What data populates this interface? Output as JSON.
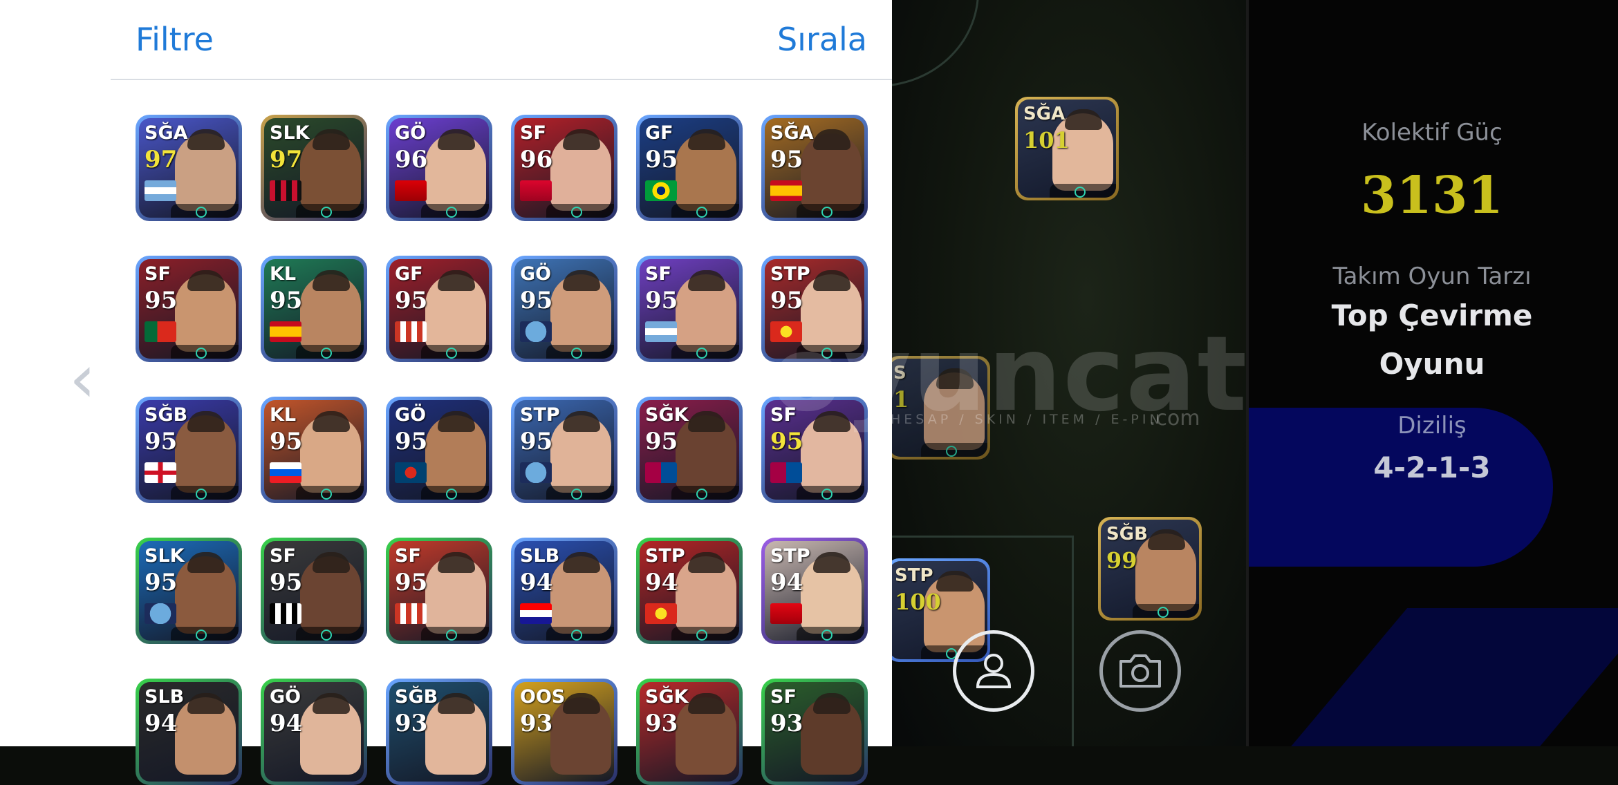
{
  "panel": {
    "filter_label": "Filtre",
    "sort_label": "Sırala"
  },
  "players": [
    {
      "pos": "SĞA",
      "rating": "97",
      "gold": true,
      "frame": "#6aa6ff",
      "bg": "#4a56c8",
      "skin": "#caa083",
      "flag": "argentina"
    },
    {
      "pos": "SLK",
      "rating": "97",
      "gold": true,
      "frame": "#c9a24a",
      "bg": "#2b4a2a",
      "skin": "#7b5035",
      "flag": "acmilan"
    },
    {
      "pos": "GÖ",
      "rating": "96",
      "gold": false,
      "frame": "#6aa6ff",
      "bg": "#6c3fd0",
      "skin": "#e2b79b",
      "flag": "arsenal"
    },
    {
      "pos": "SF",
      "rating": "96",
      "gold": false,
      "frame": "#6aa6ff",
      "bg": "#b32028",
      "skin": "#e0b09a",
      "flag": "bayern"
    },
    {
      "pos": "GF",
      "rating": "95",
      "gold": false,
      "frame": "#6aa6ff",
      "bg": "#1c3e84",
      "skin": "#a9764e",
      "flag": "brazil"
    },
    {
      "pos": "SĞA",
      "rating": "95",
      "gold": false,
      "frame": "#6aa6ff",
      "bg": "#a56c22",
      "skin": "#6b4430",
      "flag": "spain"
    },
    {
      "pos": "SF",
      "rating": "95",
      "gold": false,
      "frame": "#6aa6ff",
      "bg": "#8b1f28",
      "skin": "#c9956f",
      "flag": "portugal"
    },
    {
      "pos": "KL",
      "rating": "95",
      "gold": false,
      "frame": "#6aa6ff",
      "bg": "#1f7a55",
      "skin": "#b98561",
      "flag": "spain"
    },
    {
      "pos": "GF",
      "rating": "95",
      "gold": false,
      "frame": "#6aa6ff",
      "bg": "#9e1f2a",
      "skin": "#e3b69a",
      "flag": "atletico"
    },
    {
      "pos": "GÖ",
      "rating": "95",
      "gold": false,
      "frame": "#6aa6ff",
      "bg": "#3e73b5",
      "skin": "#cf9c7b",
      "flag": "mancity"
    },
    {
      "pos": "SF",
      "rating": "95",
      "gold": false,
      "frame": "#6aa6ff",
      "bg": "#6f3fc0",
      "skin": "#d5a184",
      "flag": "argentina"
    },
    {
      "pos": "STP",
      "rating": "95",
      "gold": false,
      "frame": "#6aa6ff",
      "bg": "#a82a2a",
      "skin": "#e4bba1",
      "flag": "manutd"
    },
    {
      "pos": "SĞB",
      "rating": "95",
      "gold": false,
      "frame": "#6aa6ff",
      "bg": "#3a3aa8",
      "skin": "#8a5b40",
      "flag": "england"
    },
    {
      "pos": "KL",
      "rating": "95",
      "gold": false,
      "frame": "#6aa6ff",
      "bg": "#c2552a",
      "skin": "#d9a886",
      "flag": "slovenia"
    },
    {
      "pos": "GÖ",
      "rating": "95",
      "gold": false,
      "frame": "#6aa6ff",
      "bg": "#1f2f7a",
      "skin": "#b27d58",
      "flag": "psg"
    },
    {
      "pos": "STP",
      "rating": "95",
      "gold": false,
      "frame": "#6aa6ff",
      "bg": "#3b67b0",
      "skin": "#e0b398",
      "flag": "mancity"
    },
    {
      "pos": "SĞK",
      "rating": "95",
      "gold": false,
      "frame": "#6aa6ff",
      "bg": "#8a1d4a",
      "skin": "#6a4231",
      "flag": "barcelona"
    },
    {
      "pos": "SF",
      "rating": "95",
      "gold": true,
      "frame": "#6aa6ff",
      "bg": "#5a2f8f",
      "skin": "#e2b7a0",
      "flag": "barcelona"
    },
    {
      "pos": "SLK",
      "rating": "95",
      "gold": false,
      "frame": "#38d24a",
      "bg": "#1c6bb8",
      "skin": "#8b5a3e",
      "flag": "mancity"
    },
    {
      "pos": "SF",
      "rating": "95",
      "gold": false,
      "frame": "#38d24a",
      "bg": "#3a3a3a",
      "skin": "#6b4432",
      "flag": "fulham"
    },
    {
      "pos": "SF",
      "rating": "95",
      "gold": false,
      "frame": "#38d24a",
      "bg": "#c23a2a",
      "skin": "#e0b49b",
      "flag": "atletico"
    },
    {
      "pos": "SLB",
      "rating": "94",
      "gold": false,
      "frame": "#6aa6ff",
      "bg": "#2a4fb0",
      "skin": "#c99676",
      "flag": "croatia"
    },
    {
      "pos": "STP",
      "rating": "94",
      "gold": false,
      "frame": "#38d24a",
      "bg": "#b42525",
      "skin": "#d9a58b",
      "flag": "manutd"
    },
    {
      "pos": "STP",
      "rating": "94",
      "gold": false,
      "frame": "#9b5de5",
      "bg": "#c8b7b0",
      "skin": "#e6c3a5",
      "flag": "munich"
    },
    {
      "pos": "SLB",
      "rating": "94",
      "gold": false,
      "frame": "#38d24a",
      "bg": "#2a2a2a",
      "skin": "#c3906d",
      "flag": "none"
    },
    {
      "pos": "GÖ",
      "rating": "94",
      "gold": false,
      "frame": "#38d24a",
      "bg": "#3a3a3a",
      "skin": "#e0b59a",
      "flag": "none"
    },
    {
      "pos": "SĞB",
      "rating": "93",
      "gold": false,
      "frame": "#6aa6ff",
      "bg": "#1f4f6e",
      "skin": "#e2b69b",
      "flag": "none"
    },
    {
      "pos": "OOS",
      "rating": "93",
      "gold": false,
      "frame": "#6aa6ff",
      "bg": "#d4a11e",
      "skin": "#6b4432",
      "flag": "none"
    },
    {
      "pos": "SĞK",
      "rating": "93",
      "gold": false,
      "frame": "#38d24a",
      "bg": "#b82a2a",
      "skin": "#7a4d36",
      "flag": "none"
    },
    {
      "pos": "SF",
      "rating": "93",
      "gold": false,
      "frame": "#38d24a",
      "bg": "#2b5e2b",
      "skin": "#5e3b2a",
      "flag": "none"
    }
  ],
  "pitch": {
    "watermark": "oyuncatış",
    "watermark_sub": "HESAP / SKIN / ITEM / E-PIN",
    "watermark_dotcom": ".com",
    "players": [
      {
        "pos": "SĞA",
        "rating": "101"
      },
      {
        "pos": "S",
        "rating": "1"
      },
      {
        "pos": "SĞB",
        "rating": "99"
      },
      {
        "pos": "STP",
        "rating": "100"
      }
    ]
  },
  "info": {
    "power_label": "Kolektif Güç",
    "power_value": "3131",
    "style_label": "Takım Oyun Tarzı",
    "style_value_line1": "Top Çevirme",
    "style_value_line2": "Oyunu",
    "formation_label": "Diziliş",
    "formation_value": "4-2-1-3"
  },
  "icons": {
    "back": "chevron-left-icon",
    "profile": "person-icon",
    "camera": "camera-icon"
  },
  "colors": {
    "accent_blue": "#1f7ad8",
    "power_yellow": "#c9c01d",
    "info_pill": "#04075d"
  }
}
